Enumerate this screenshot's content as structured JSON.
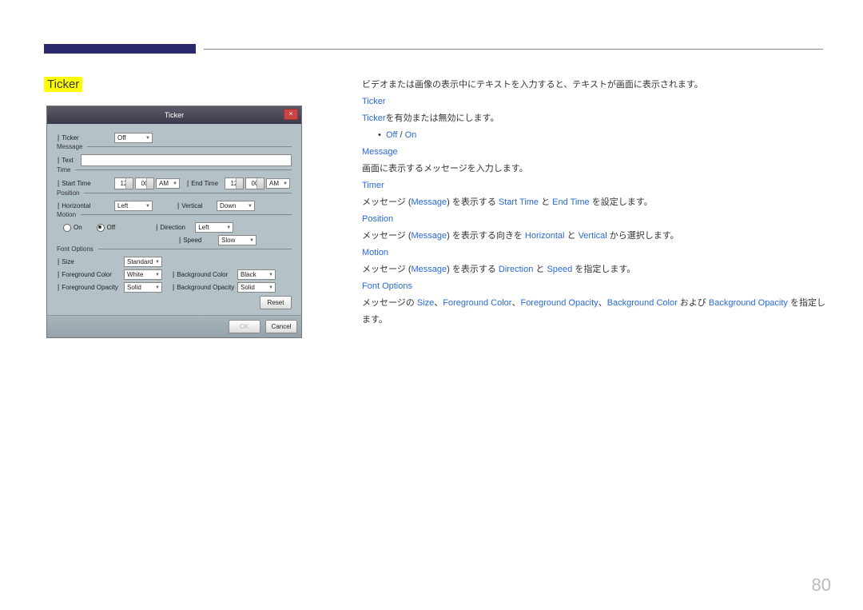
{
  "header": {
    "section_title": "Ticker"
  },
  "dialog": {
    "title": "Ticker",
    "close": "×",
    "groups": {
      "ticker": {
        "label": "Ticker",
        "value": "Off"
      },
      "message": {
        "label": "Message",
        "field": "Text"
      },
      "time": {
        "label": "Time",
        "start": "Start Time",
        "end": "End Time",
        "h1": "12",
        "m1": "00",
        "ap1": "AM",
        "h2": "12",
        "m2": "00",
        "ap2": "AM"
      },
      "position": {
        "label": "Position",
        "h_label": "Horizontal",
        "h_value": "Left",
        "v_label": "Vertical",
        "v_value": "Down"
      },
      "motion": {
        "label": "Motion",
        "on": "On",
        "off": "Off",
        "dir_label": "Direction",
        "dir_value": "Left",
        "spd_label": "Speed",
        "spd_value": "Slow"
      },
      "font": {
        "label": "Font Options",
        "size_label": "Size",
        "size_value": "Standard",
        "fg_label": "Foreground Color",
        "fg_value": "White",
        "fo_label": "Foreground Opacity",
        "fo_value": "Solid",
        "bg_label": "Background Color",
        "bg_value": "Black",
        "bo_label": "Background Opacity",
        "bo_value": "Solid",
        "reset": "Reset"
      }
    },
    "buttons": {
      "ok": "OK",
      "cancel": "Cancel"
    }
  },
  "dsc": {
    "intro": "ビデオまたは画像の表示中にテキストを入力すると、テキストが画面に表示されます。",
    "t_title": "Ticker",
    "t_pre": "Ticker",
    "t_post": "を有効または無効にします。",
    "off": "Off",
    "on": "On",
    "slash": " / ",
    "m_title": "Message",
    "m_desc": "画面に表示するメッセージを入力します。",
    "tm_title": "Timer",
    "tm_p1": "メッセージ (",
    "tm_msg": "Message",
    "tm_p2": ") を表示する ",
    "st": "Start Time",
    "and1": " と ",
    "et": "End Time",
    "tm_p3": " を設定します。",
    "p_title": "Position",
    "p_p1": "メッセージ (",
    "p_msg": "Message",
    "p_p2": ") を表示する向きを ",
    "hz": "Horizontal",
    "and2": " と ",
    "vt": "Vertical",
    "p_p3": " から選択します。",
    "mo_title": "Motion",
    "mo_p1": "メッセージ (",
    "mo_msg": "Message",
    "mo_p2": ") を表示する ",
    "dir": "Direction",
    "and3": " と ",
    "spd": "Speed",
    "mo_p3": " を指定します。",
    "f_title": "Font Options",
    "f_p1": "メッセージの ",
    "sz": "Size",
    "c1": "、",
    "fgc": "Foreground Color",
    "c2": "、",
    "fgo": "Foreground Opacity",
    "c3": "、",
    "bgc": "Background Color",
    "f_p2": " および ",
    "bgo": "Background Opacity",
    "f_p3": " を指定します。"
  },
  "page": "80"
}
